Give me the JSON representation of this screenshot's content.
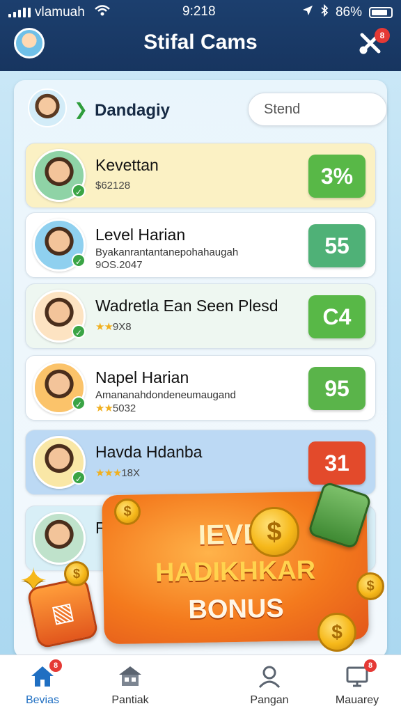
{
  "status_bar": {
    "carrier": "vlamuah",
    "time": "9:218",
    "battery": "86%"
  },
  "header": {
    "title": "Stifal Cams",
    "badge": "8"
  },
  "user": {
    "name": "Dandagiy",
    "search_placeholder": "Stend"
  },
  "cards": [
    {
      "title": "Kevettan",
      "line1": "",
      "line2": "$62128",
      "line2_stars": "",
      "score": "3%",
      "score_color": "#58b847",
      "bg": "#fbf1c4",
      "avatar_bg": "#8fd3a6"
    },
    {
      "title": "Level Harian",
      "line1": "Byakanrantantanepohahaugah",
      "line2": "9OS.2047",
      "line2_stars": "",
      "score": "55",
      "score_color": "#4fb177",
      "bg": "#ffffff",
      "avatar_bg": "#8fd0ef"
    },
    {
      "title": "Wadretla Ean Seen Plesd",
      "line1": "",
      "line2": "9X8",
      "line2_stars": "★★",
      "score": "C4",
      "score_color": "#58b847",
      "bg": "#eef7f1",
      "avatar_bg": "#fde3c2"
    },
    {
      "title": "Napel Harian",
      "line1": "Amananahdondeneumaugand",
      "line2": "5032",
      "line2_stars": "★★",
      "score": "95",
      "score_color": "#5ab44a",
      "bg": "#ffffff",
      "avatar_bg": "#fbc36a"
    },
    {
      "title": "Havda Hdanba",
      "line1": "",
      "line2": "18X",
      "line2_stars": "★★★",
      "score": "31",
      "score_color": "#e34a2b",
      "bg": "#bcd9f4",
      "avatar_bg": "#f9e7a6"
    },
    {
      "title": "Fl",
      "line1": "",
      "line2": "",
      "line2_stars": "",
      "score": "",
      "score_color": "",
      "bg": "#d8eff7",
      "avatar_bg": "#bfe2cb"
    }
  ],
  "bonus": {
    "line1": "IEVD.",
    "line2": "HADIKHKAR",
    "line3": "BONUS"
  },
  "nav": [
    {
      "label": "Bevias",
      "icon": "home-icon",
      "badge": "8"
    },
    {
      "label": "Pantiak",
      "icon": "shop-icon",
      "badge": ""
    },
    {
      "label": "Pangan",
      "icon": "profile-icon",
      "badge": ""
    },
    {
      "label": "Mauarey",
      "icon": "monitor-icon",
      "badge": "8"
    }
  ],
  "colors": {
    "header_bg": "#1c3f6e",
    "accent": "#1f6fc2",
    "bonus_orange": "#f47a1d"
  }
}
